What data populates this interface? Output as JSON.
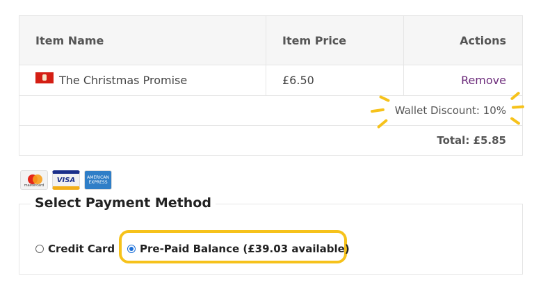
{
  "table": {
    "headers": {
      "name": "Item Name",
      "price": "Item Price",
      "actions": "Actions"
    },
    "items": [
      {
        "name": "The Christmas Promise",
        "price": "£6.50",
        "action": "Remove"
      }
    ],
    "discount": "Wallet Discount: 10%",
    "total": "Total: £5.85"
  },
  "cards": [
    {
      "name": "mastercard",
      "label": "mastercard"
    },
    {
      "name": "visa",
      "label": "VISA"
    },
    {
      "name": "amex",
      "label": "AMERICAN EXPRESS"
    }
  ],
  "payment": {
    "title": "Select Payment Method",
    "options": [
      {
        "label": "Credit Card",
        "selected": false
      },
      {
        "label": "Pre-Paid Balance (£39.03 available)",
        "selected": true
      }
    ]
  },
  "colors": {
    "highlight": "#f6c21b",
    "remove_link": "#6b2a7a",
    "radio_selected": "#1b6fd8"
  }
}
